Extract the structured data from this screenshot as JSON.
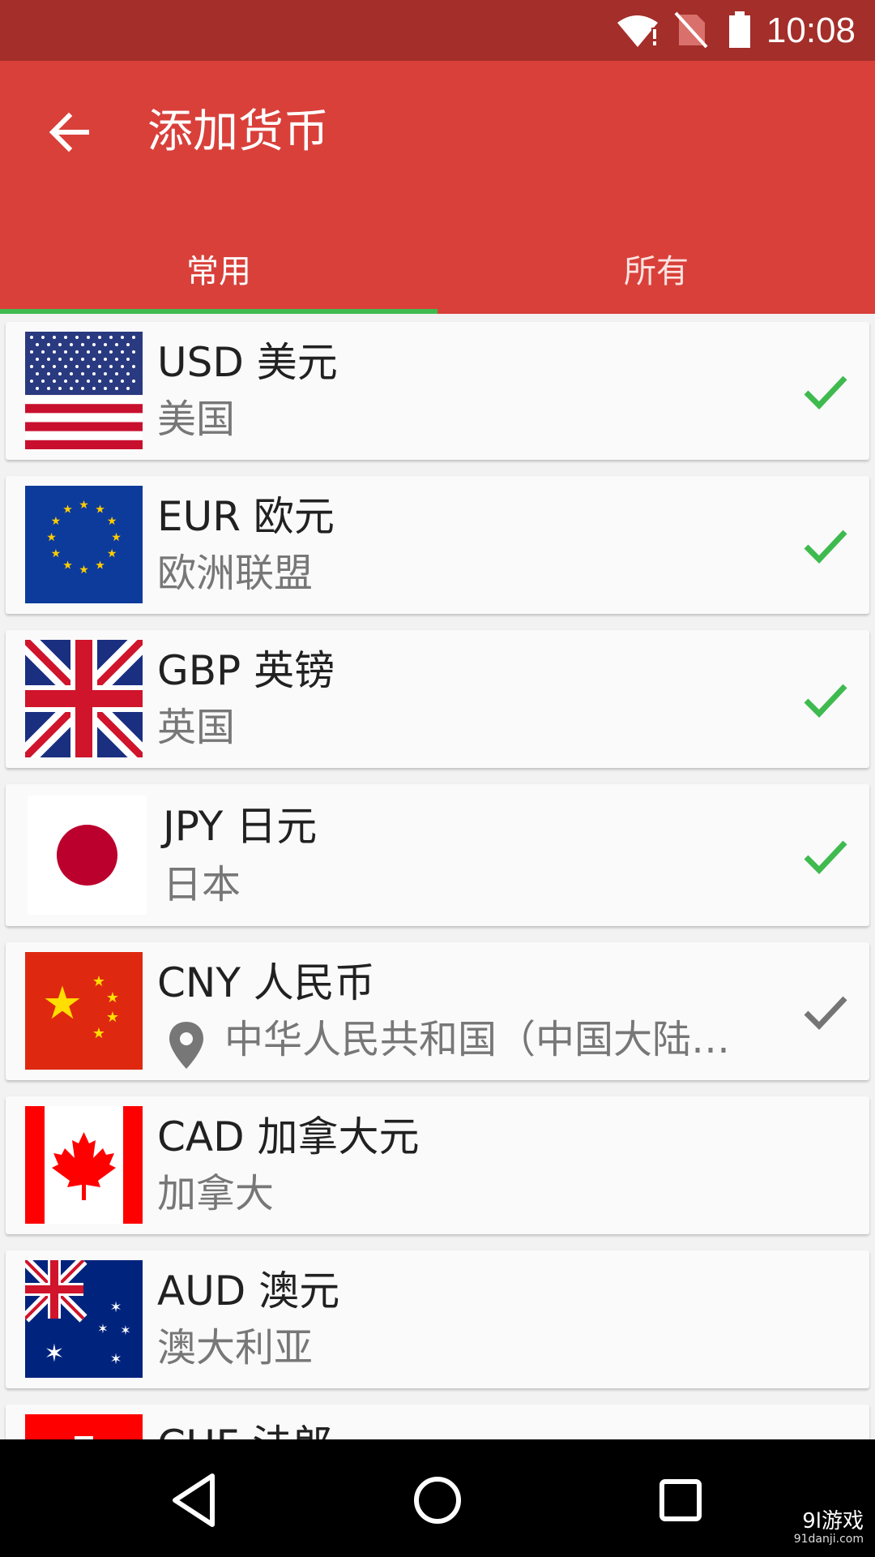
{
  "status_bar": {
    "time": "10:08"
  },
  "app_bar": {
    "title": "添加货币"
  },
  "tabs": [
    {
      "label": "常用",
      "selected": true
    },
    {
      "label": "所有",
      "selected": false
    }
  ],
  "colors": {
    "status_bar": "#a32e2a",
    "app_bar": "#d9403a",
    "tab_indicator": "#3fba4f",
    "check_selected": "#3fba4f",
    "check_default": "#757575"
  },
  "currencies": [
    {
      "code_name": "USD 美元",
      "country": "美国",
      "flag": "us-flag-icon",
      "checked": true
    },
    {
      "code_name": "EUR 欧元",
      "country": "欧洲联盟",
      "flag": "eu-flag-icon",
      "checked": true
    },
    {
      "code_name": "GBP 英镑",
      "country": "英国",
      "flag": "uk-flag-icon",
      "checked": true
    },
    {
      "code_name": "JPY 日元",
      "country": "日本",
      "flag": "japan-flag-icon",
      "checked": true
    },
    {
      "code_name": "CNY 人民币",
      "country": "中华人民共和国（中国大陆…",
      "flag": "china-flag-icon",
      "checked": true,
      "location_pin": true
    },
    {
      "code_name": "CAD 加拿大元",
      "country": "加拿大",
      "flag": "canada-flag-icon",
      "checked": false
    },
    {
      "code_name": "AUD 澳元",
      "country": "澳大利亚",
      "flag": "australia-flag-icon",
      "checked": false
    },
    {
      "code_name": "CHF 法郎",
      "country": "",
      "flag": "switzerland-flag-icon",
      "checked": false
    }
  ],
  "watermark": {
    "brand": "9l游戏",
    "site": "91danji.com"
  }
}
